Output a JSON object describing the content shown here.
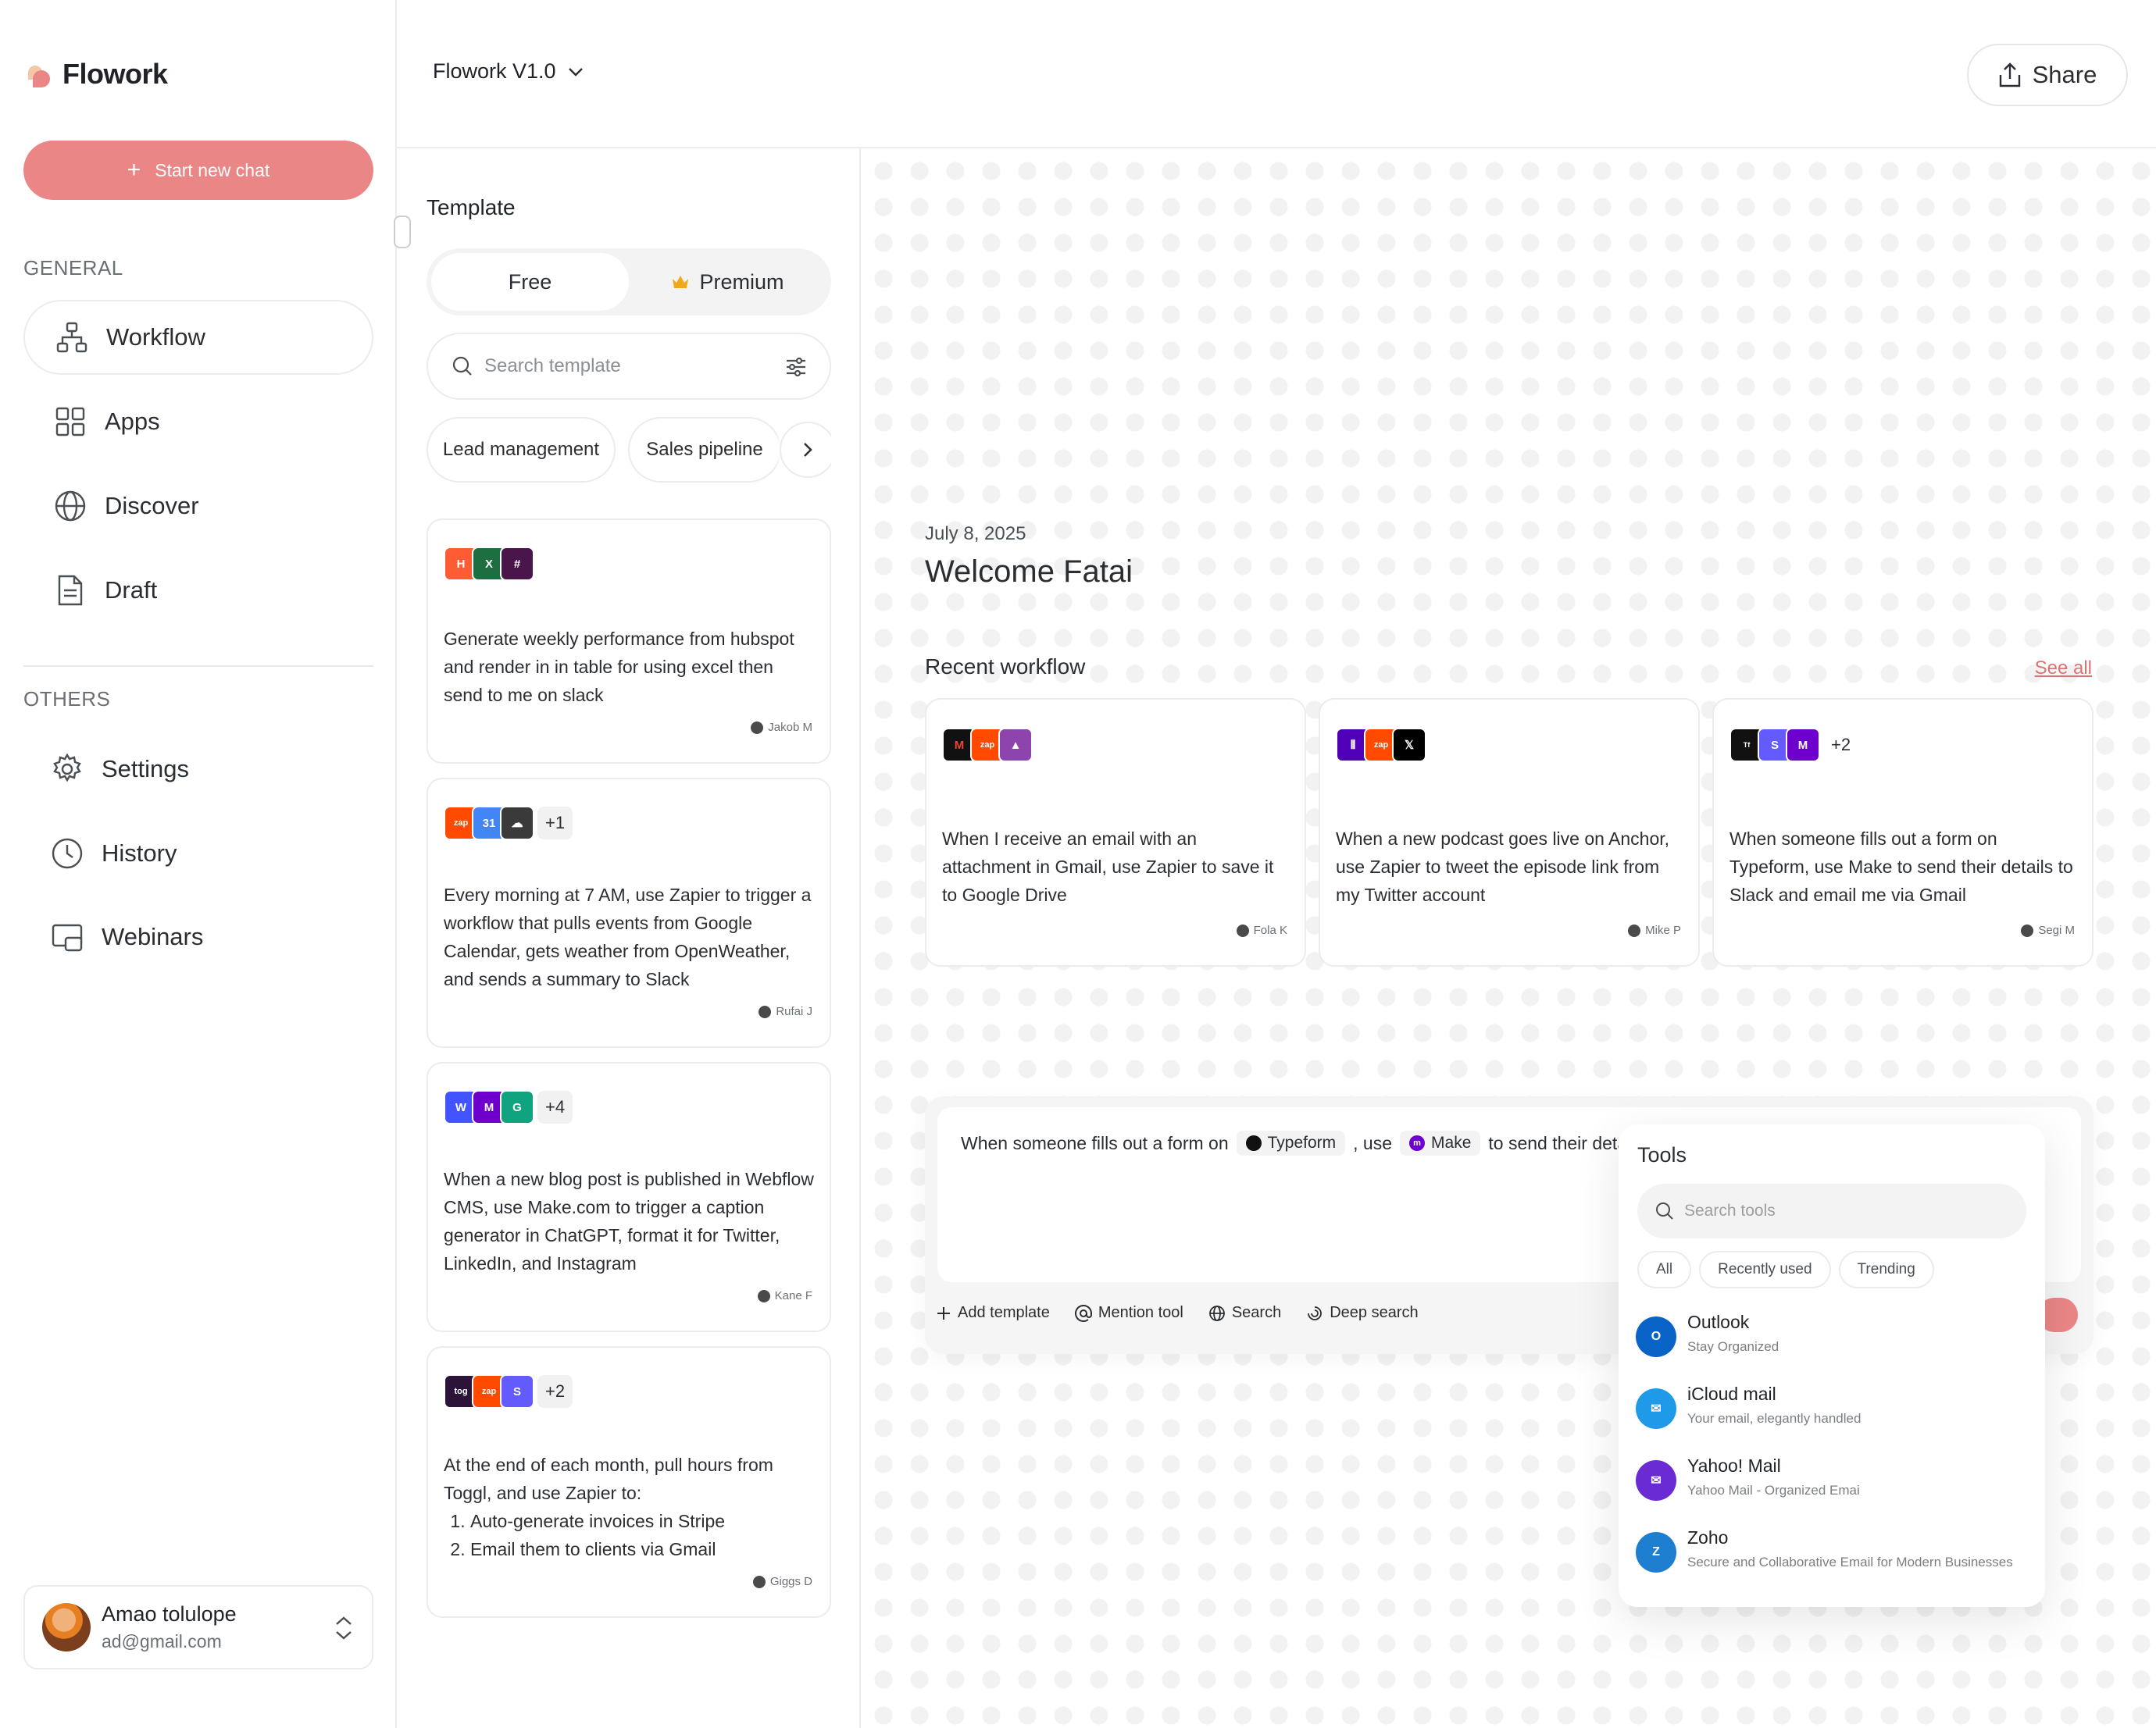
{
  "app": {
    "title": "Flowork",
    "version": "Flowork V1.0"
  },
  "sidebar": {
    "new_chat": "Start new chat",
    "general_label": "GENERAL",
    "others_label": "OTHERS",
    "general_items": [
      {
        "label": "Workflow",
        "icon": "workflow-icon"
      },
      {
        "label": "Apps",
        "icon": "apps-icon"
      },
      {
        "label": "Discover",
        "icon": "globe-icon"
      },
      {
        "label": "Draft",
        "icon": "document-icon"
      }
    ],
    "other_items": [
      {
        "label": "Settings",
        "icon": "gear-icon"
      },
      {
        "label": "History",
        "icon": "clock-icon"
      },
      {
        "label": "Webinars",
        "icon": "webinar-icon"
      }
    ],
    "user": {
      "name": "Amao tolulope",
      "email": "ad@gmail.com"
    }
  },
  "topbar": {
    "share": "Share"
  },
  "template": {
    "title": "Template",
    "tabs": {
      "free": "Free",
      "premium": "Premium"
    },
    "search_placeholder": "Search template",
    "chips": [
      "Lead management",
      "Sales pipeline"
    ],
    "cards": [
      {
        "text": "Generate weekly performance  from hubspot and render in in table for using excel then send to me on slack",
        "author": "Jakob M",
        "more": ""
      },
      {
        "text": "Every morning at 7 AM, use Zapier to trigger a workflow that pulls events from Google Calendar, gets weather from OpenWeather, and sends a summary to Slack",
        "author": "Rufai J",
        "more": "+1"
      },
      {
        "text": "When a new blog post is published in Webflow CMS, use Make.com to trigger a caption generator in ChatGPT, format it for Twitter, LinkedIn, and Instagram",
        "author": "Kane F",
        "more": "+4"
      },
      {
        "text": "At the end of each month, pull hours from Toggl, and use Zapier to:",
        "list": [
          "Auto-generate invoices in Stripe",
          "Email them to clients via Gmail"
        ],
        "author": "Giggs D",
        "more": "+2"
      }
    ]
  },
  "main": {
    "date": "July 8, 2025",
    "welcome": "Welcome Fatai",
    "recent_title": "Recent workflow",
    "see_all": "See all",
    "recent": [
      {
        "text": "When I receive an email with an attachment in Gmail, use Zapier to save it to Google Drive",
        "author": "Fola K",
        "more": ""
      },
      {
        "text": "When a new podcast goes live on Anchor, use Zapier to tweet the episode link from my Twitter account",
        "author": "Mike P",
        "more": ""
      },
      {
        "text": "When someone fills out a form on Typeform, use Make to send their details to Slack and email me via Gmail",
        "author": "Segi M",
        "more": "+2"
      }
    ],
    "composer": {
      "prompt_start": "When someone fills out a form on",
      "tag1": "Typeform",
      "prompt_mid": ", use",
      "tag2": "Make",
      "prompt_end": "to send their details",
      "actions": [
        "Add template",
        "Mention tool",
        "Search",
        "Deep search"
      ]
    },
    "tools": {
      "title": "Tools",
      "search_placeholder": "Search tools",
      "tabs": [
        "All",
        "Recently used",
        "Trending"
      ],
      "items": [
        {
          "name": "Outlook",
          "desc": "Stay Organized",
          "color": "#0a64c8"
        },
        {
          "name": "iCloud mail",
          "desc": "Your email, elegantly handled",
          "color": "#1e9ae8"
        },
        {
          "name": "Yahoo! Mail",
          "desc": "Yahoo Mail - Organized Emai",
          "color": "#6a2bd4"
        },
        {
          "name": "Zoho",
          "desc": "Secure and Collaborative Email for Modern Businesses",
          "color": "#1e7fd0"
        }
      ]
    }
  }
}
